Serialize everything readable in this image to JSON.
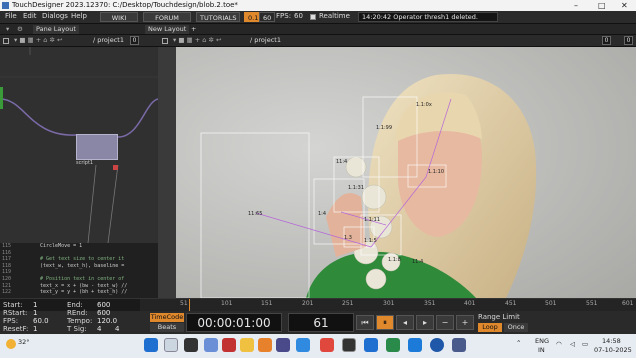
{
  "window": {
    "title": "TouchDesigner 2023.12370: C:/Desktop/Touchdesign/blob.2.toe*"
  },
  "menu": {
    "items": [
      "File",
      "Edit",
      "Dialogs",
      "Help"
    ],
    "links": [
      "WIKI",
      "FORUM",
      "TUTORIALS"
    ],
    "perf_value": "0.1",
    "fps_target": "60",
    "fps_label": "FPS:",
    "fps_value": "60",
    "realtime_label": "Realtime",
    "status_message": "14:20:42 Operator thresh1 deleted."
  },
  "tabs": {
    "pane_layout": "Pane Layout",
    "new_layout": "New Layout",
    "add": "+"
  },
  "left_pane": {
    "path": "/ project1",
    "counter": "0"
  },
  "right_pane": {
    "path": "/ project1",
    "counter_a": "0",
    "counter_b": "0"
  },
  "network": {
    "node_label": "script1"
  },
  "dat": {
    "lines": [
      {
        "n": "115",
        "code": "CircleMove = 1"
      },
      {
        "n": "116",
        "code": ""
      },
      {
        "n": "117",
        "code": "# Get text size to center it",
        "comment": true
      },
      {
        "n": "118",
        "code": "(text_w, text_h), baseline ="
      },
      {
        "n": "119",
        "code": ""
      },
      {
        "n": "120",
        "code": "# Position text in center of",
        "comment": true
      },
      {
        "n": "121",
        "code": "text_x = x + (bw - text_w) //"
      },
      {
        "n": "122",
        "code": "text_y = y + (bh + text_h) //"
      }
    ]
  },
  "overlay_labels": [
    "1.1:99",
    "1.1:0x",
    "11:4",
    "1.1:31",
    "11:65",
    "1:4",
    "1.1:10",
    "1.1:11",
    "1.1:5",
    "1.1:8",
    "11:4",
    "1.3"
  ],
  "timeline": {
    "ticks": [
      "51",
      "101",
      "151",
      "201",
      "251",
      "301",
      "351",
      "401",
      "451",
      "501",
      "551",
      "601"
    ]
  },
  "transport": {
    "start_label": "Start:",
    "start": "1",
    "rstart_label": "RStart:",
    "rstart": "1",
    "fps_label": "FPS:",
    "fps": "60.0",
    "resetf_label": "ResetF:",
    "resetf": "1",
    "end_label": "End:",
    "end": "600",
    "rend_label": "REnd:",
    "rend": "600",
    "tempo_label": "Tempo:",
    "tempo": "120.0",
    "tsig_label": "T Sig:",
    "tsig_a": "4",
    "tsig_b": "4",
    "timecode_btn": "TimeCode",
    "beats_btn": "Beats",
    "timecode": "00:00:01:00",
    "frame": "61",
    "range_limit_label": "Range Limit",
    "loop_btn": "Loop",
    "once_btn": "Once"
  },
  "taskbar": {
    "weather_temp": "32°",
    "lang_top": "ENG",
    "lang_bottom": "IN",
    "time": "14:58",
    "date": "07-10-2025"
  },
  "colors": {
    "accent_orange": "#e0882c",
    "node_purple": "#7b6aa8",
    "wire_purple": "#c86fd6"
  }
}
